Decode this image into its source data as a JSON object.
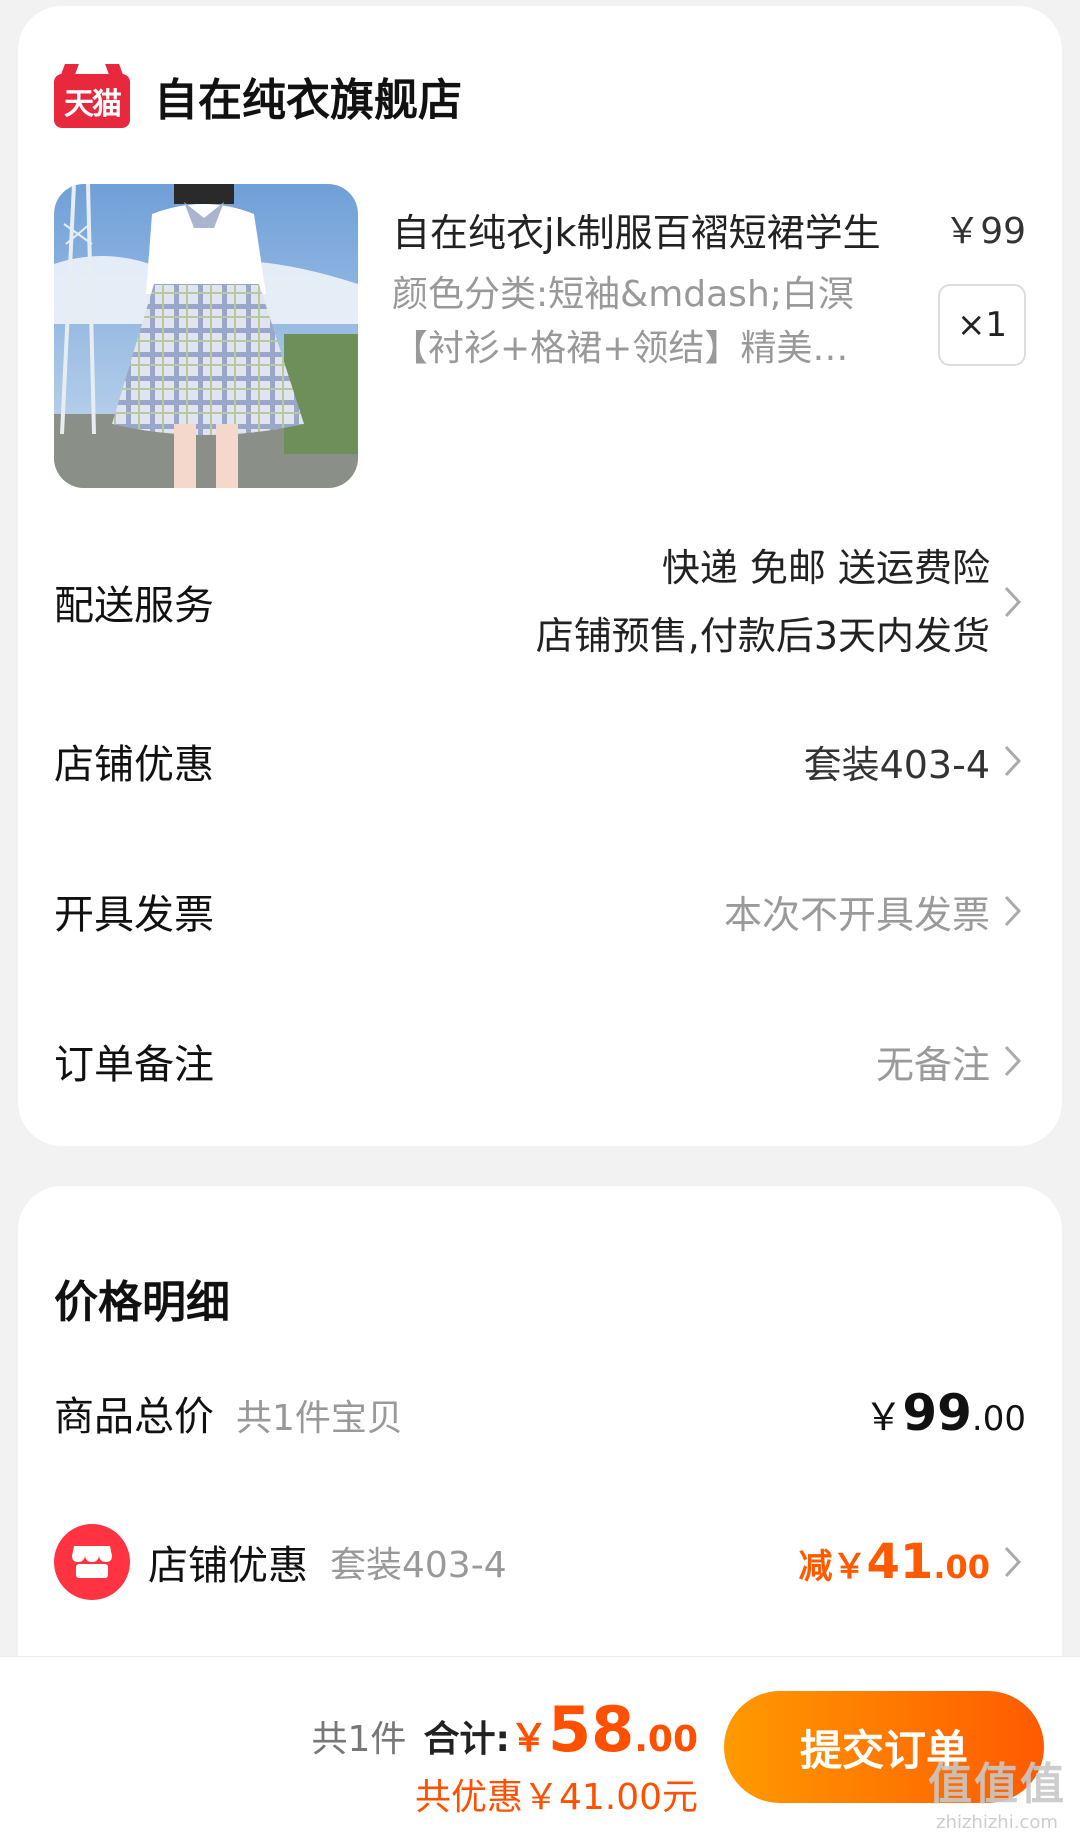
{
  "store": {
    "badge": "天猫",
    "name": "自在纯衣旗舰店"
  },
  "product": {
    "title": "自在纯衣jk制服百褶短裙学生",
    "price": "￥99",
    "sku": "颜色分类:短袖&mdash;白溟【衬衫+格裙+领结】精美…",
    "quantity": "×1"
  },
  "rows": {
    "delivery": {
      "label": "配送服务",
      "line1": "快递 免邮 送运费险",
      "line2": "店铺预售,付款后3天内发货"
    },
    "shop_discount": {
      "label": "店铺优惠",
      "value": "套装403-4"
    },
    "invoice": {
      "label": "开具发票",
      "value": "本次不开具发票"
    },
    "note": {
      "label": "订单备注",
      "value": "无备注"
    }
  },
  "price_detail": {
    "title": "价格明细",
    "goods_total": {
      "label": "商品总价",
      "sub": "共1件宝贝",
      "currency": "￥",
      "integer": "99",
      "decimal": ".00"
    },
    "discount": {
      "label": "店铺优惠",
      "sub": "套装403-4",
      "prefix": "减￥",
      "integer": "41",
      "decimal": ".00"
    }
  },
  "bottom_bar": {
    "count": "共1件",
    "total_label": "合计:",
    "currency": "￥",
    "integer": "58",
    "decimal": ".00",
    "saved": "共优惠￥41.00元",
    "submit_label": "提交订单"
  },
  "watermark": {
    "main": "值值值",
    "sub": "zhizhizhi.com"
  },
  "colors": {
    "tmall_red": "#e8283c",
    "accent_orange": "#ff5000",
    "button_gradient_start": "#ff9a00",
    "button_gradient_end": "#ff5a00",
    "shop_icon_red": "#ff3341"
  }
}
